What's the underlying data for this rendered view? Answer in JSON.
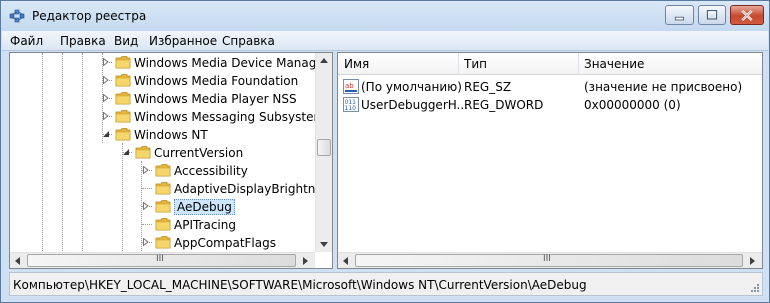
{
  "window": {
    "title": "Редактор реестра"
  },
  "menu": [
    "Файл",
    "Правка",
    "Вид",
    "Избранное",
    "Справка"
  ],
  "tree": {
    "items": [
      {
        "label": "Windows Media Device Manager",
        "expander": "collapsed"
      },
      {
        "label": "Windows Media Foundation",
        "expander": "collapsed"
      },
      {
        "label": "Windows Media Player NSS",
        "expander": "collapsed"
      },
      {
        "label": "Windows Messaging Subsystem",
        "expander": "collapsed"
      },
      {
        "label": "Windows NT",
        "expander": "expanded"
      },
      {
        "label": "CurrentVersion",
        "expander": "expanded"
      },
      {
        "label": "Accessibility",
        "expander": "collapsed"
      },
      {
        "label": "AdaptiveDisplayBrightness",
        "expander": "none"
      },
      {
        "label": "AeDebug",
        "expander": "collapsed",
        "selected": true
      },
      {
        "label": "APITracing",
        "expander": "none"
      },
      {
        "label": "AppCompatFlags",
        "expander": "collapsed"
      }
    ]
  },
  "list": {
    "columns": [
      "Имя",
      "Тип",
      "Значение"
    ],
    "rows": [
      {
        "name": "(По умолчанию)",
        "type": "REG_SZ",
        "value": "(значение не присвоено)",
        "icon": "string-value-icon"
      },
      {
        "name": "UserDebuggerH...",
        "type": "REG_DWORD",
        "value": "0x00000000 (0)",
        "icon": "binary-value-icon"
      }
    ]
  },
  "scrollbars": {
    "hscroll_grip": "III"
  },
  "status": {
    "path": "Компьютер\\HKEY_LOCAL_MACHINE\\SOFTWARE\\Microsoft\\Windows NT\\CurrentVersion\\AeDebug"
  },
  "colors": {
    "selection": "#cde6ff",
    "folder": "#f2c94c",
    "titlebar": "#cfe0f3",
    "close_button": "#c5482f"
  }
}
